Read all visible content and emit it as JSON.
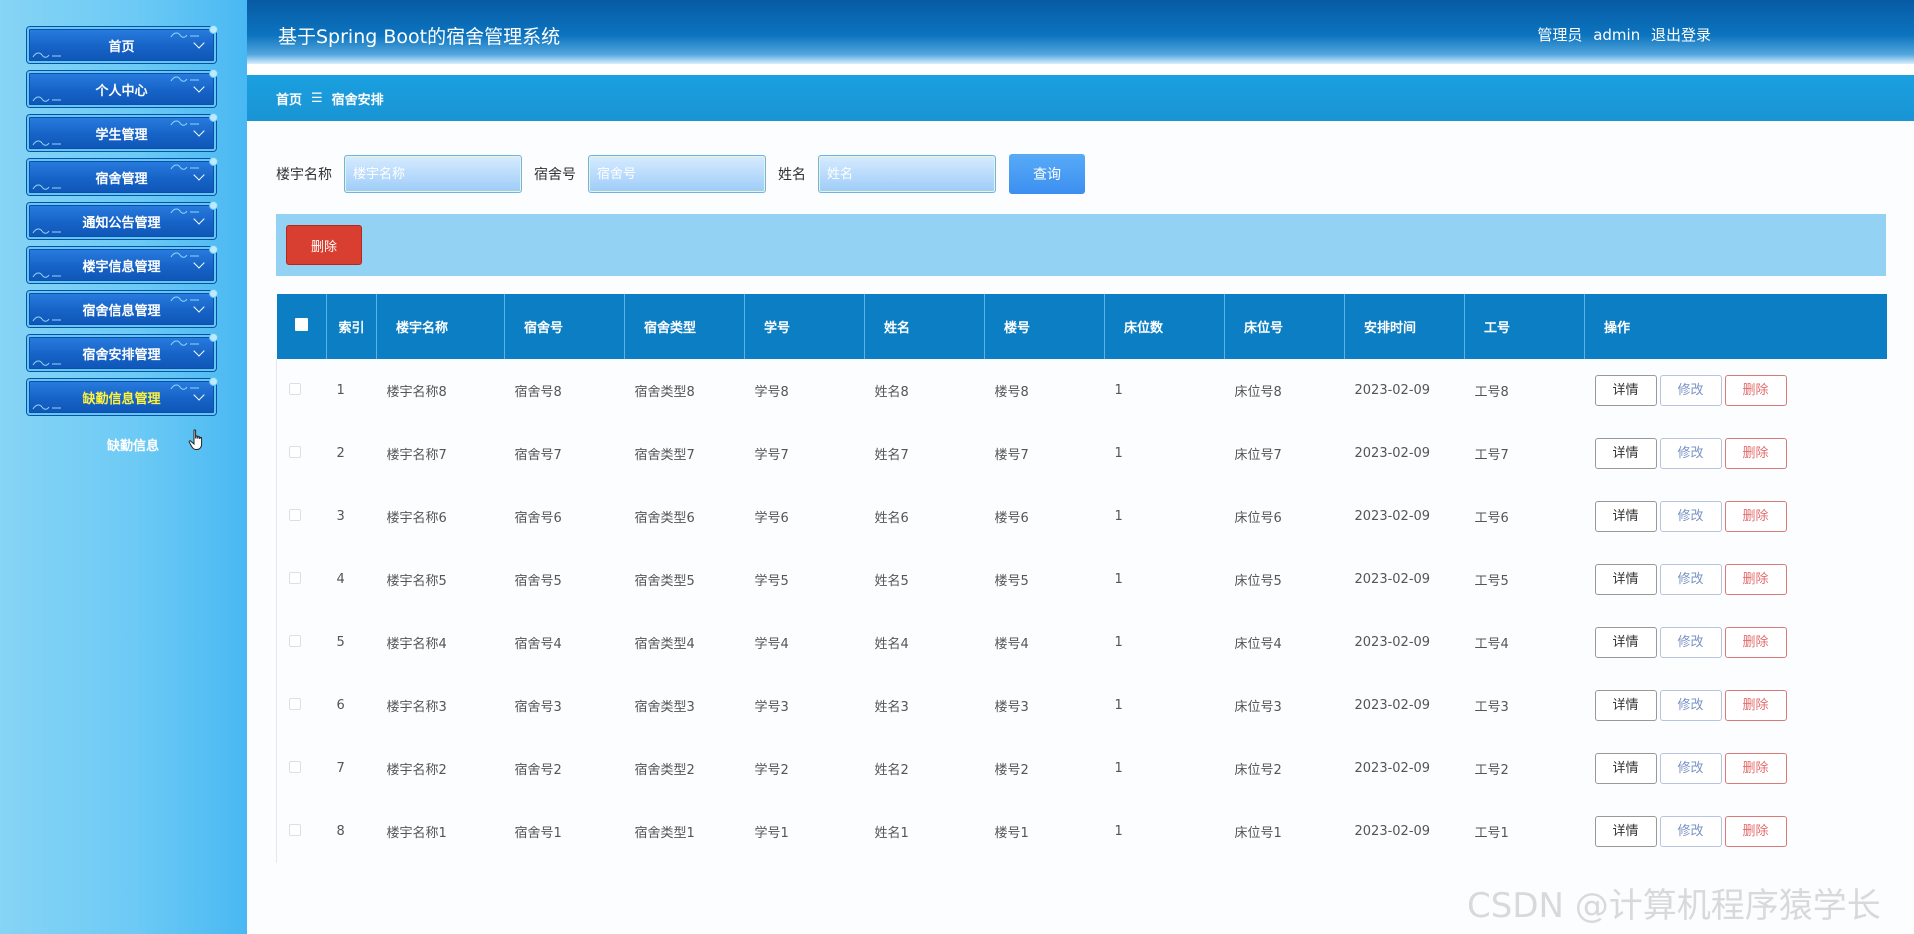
{
  "header": {
    "title": "基于Spring Boot的宿舍管理系统",
    "role": "管理员",
    "username": "admin",
    "logout": "退出登录"
  },
  "sidebar": {
    "items": [
      {
        "label": "首页"
      },
      {
        "label": "个人中心"
      },
      {
        "label": "学生管理"
      },
      {
        "label": "宿舍管理"
      },
      {
        "label": "通知公告管理"
      },
      {
        "label": "楼宇信息管理"
      },
      {
        "label": "宿舍信息管理"
      },
      {
        "label": "宿舍安排管理"
      },
      {
        "label": "缺勤信息管理"
      }
    ],
    "submenu": {
      "label": "缺勤信息"
    },
    "active_color": "#fff23a"
  },
  "breadcrumb": {
    "home": "首页",
    "separator": "☰",
    "current": "宿舍安排"
  },
  "search": {
    "building_label": "楼宇名称",
    "building_placeholder": "楼宇名称",
    "room_label": "宿舍号",
    "room_placeholder": "宿舍号",
    "name_label": "姓名",
    "name_placeholder": "姓名",
    "query_button": "查询"
  },
  "actions": {
    "bulk_delete": "删除"
  },
  "table": {
    "headers": [
      "",
      "索引",
      "楼宇名称",
      "宿舍号",
      "宿舍类型",
      "学号",
      "姓名",
      "楼号",
      "床位数",
      "床位号",
      "安排时间",
      "工号",
      "操作"
    ],
    "rows": [
      {
        "index": "1",
        "building": "楼宇名称8",
        "room": "宿舍号8",
        "type": "宿舍类型8",
        "student_no": "学号8",
        "name": "姓名8",
        "floor": "楼号8",
        "beds": "1",
        "bed_no": "床位号8",
        "time": "2023-02-09",
        "staff_no": "工号8"
      },
      {
        "index": "2",
        "building": "楼宇名称7",
        "room": "宿舍号7",
        "type": "宿舍类型7",
        "student_no": "学号7",
        "name": "姓名7",
        "floor": "楼号7",
        "beds": "1",
        "bed_no": "床位号7",
        "time": "2023-02-09",
        "staff_no": "工号7"
      },
      {
        "index": "3",
        "building": "楼宇名称6",
        "room": "宿舍号6",
        "type": "宿舍类型6",
        "student_no": "学号6",
        "name": "姓名6",
        "floor": "楼号6",
        "beds": "1",
        "bed_no": "床位号6",
        "time": "2023-02-09",
        "staff_no": "工号6"
      },
      {
        "index": "4",
        "building": "楼宇名称5",
        "room": "宿舍号5",
        "type": "宿舍类型5",
        "student_no": "学号5",
        "name": "姓名5",
        "floor": "楼号5",
        "beds": "1",
        "bed_no": "床位号5",
        "time": "2023-02-09",
        "staff_no": "工号5"
      },
      {
        "index": "5",
        "building": "楼宇名称4",
        "room": "宿舍号4",
        "type": "宿舍类型4",
        "student_no": "学号4",
        "name": "姓名4",
        "floor": "楼号4",
        "beds": "1",
        "bed_no": "床位号4",
        "time": "2023-02-09",
        "staff_no": "工号4"
      },
      {
        "index": "6",
        "building": "楼宇名称3",
        "room": "宿舍号3",
        "type": "宿舍类型3",
        "student_no": "学号3",
        "name": "姓名3",
        "floor": "楼号3",
        "beds": "1",
        "bed_no": "床位号3",
        "time": "2023-02-09",
        "staff_no": "工号3"
      },
      {
        "index": "7",
        "building": "楼宇名称2",
        "room": "宿舍号2",
        "type": "宿舍类型2",
        "student_no": "学号2",
        "name": "姓名2",
        "floor": "楼号2",
        "beds": "1",
        "bed_no": "床位号2",
        "time": "2023-02-09",
        "staff_no": "工号2"
      },
      {
        "index": "8",
        "building": "楼宇名称1",
        "room": "宿舍号1",
        "type": "宿舍类型1",
        "student_no": "学号1",
        "name": "姓名1",
        "floor": "楼号1",
        "beds": "1",
        "bed_no": "床位号1",
        "time": "2023-02-09",
        "staff_no": "工号1"
      }
    ],
    "row_buttons": {
      "detail": "详情",
      "edit": "修改",
      "delete": "删除"
    }
  },
  "watermark": "CSDN @计算机程序猿学长"
}
